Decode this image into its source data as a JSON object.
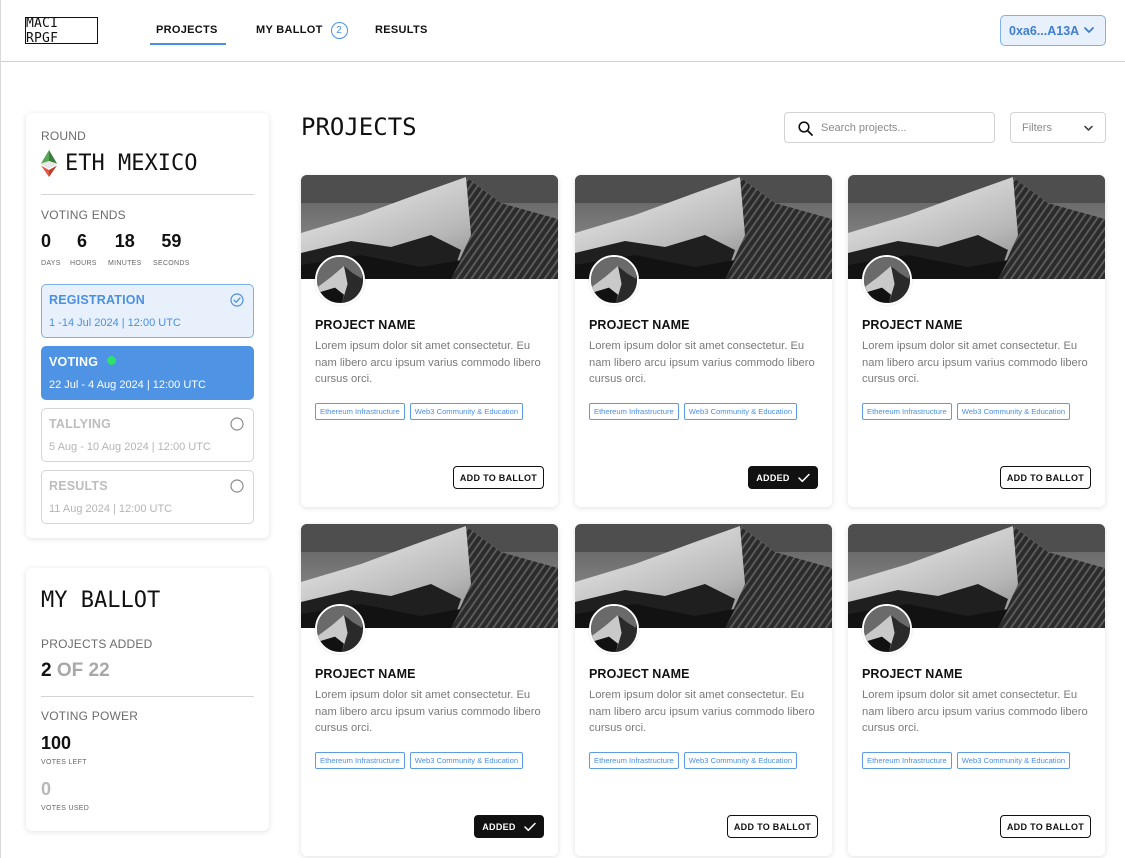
{
  "header": {
    "logo": "MACI RPGF",
    "nav": {
      "projects": "PROJECTS",
      "my_ballot": "MY BALLOT",
      "my_ballot_count": "2",
      "results": "RESULTS"
    },
    "wallet": "0xa6...A13A"
  },
  "round": {
    "label": "ROUND",
    "name": "ETH MEXICO",
    "voting_ends_label": "VOTING ENDS",
    "countdown": [
      {
        "value": "0",
        "unit": "DAYS"
      },
      {
        "value": "6",
        "unit": "HOURS"
      },
      {
        "value": "18",
        "unit": "MINUTES"
      },
      {
        "value": "59",
        "unit": "SECONDS"
      }
    ],
    "stages": [
      {
        "title": "REGISTRATION",
        "dates": "1 -14 Jul 2024 | 12:00 UTC",
        "status": "done"
      },
      {
        "title": "VOTING",
        "dates": "22 Jul - 4 Aug 2024 | 12:00 UTC",
        "status": "active"
      },
      {
        "title": "TALLYING",
        "dates": "5 Aug - 10 Aug 2024 | 12:00 UTC",
        "status": "upcoming"
      },
      {
        "title": "RESULTS",
        "dates": "11 Aug 2024 | 12:00 UTC",
        "status": "upcoming"
      }
    ]
  },
  "ballot": {
    "title": "MY BALLOT",
    "projects_added_label": "PROJECTS ADDED",
    "projects_added": "2",
    "projects_total": "OF 22",
    "voting_power_label": "VOTING POWER",
    "votes_left": "100",
    "votes_left_label": "VOTES LEFT",
    "votes_used": "0",
    "votes_used_label": "VOTES USED"
  },
  "main": {
    "title": "PROJECTS",
    "search_placeholder": "Search projects...",
    "filters_label": "Filters",
    "projects": [
      {
        "name": "PROJECT NAME",
        "description": "Lorem ipsum dolor sit amet consectetur. Eu nam libero arcu ipsum varius commodo libero cursus orci.",
        "tags": [
          "Ethereum Infrastructure",
          "Web3 Community & Education"
        ],
        "button": "ADD TO BALLOT",
        "added": false
      },
      {
        "name": "PROJECT NAME",
        "description": "Lorem ipsum dolor sit amet consectetur. Eu nam libero arcu ipsum varius commodo libero cursus orci.",
        "tags": [
          "Ethereum Infrastructure",
          "Web3 Community & Education"
        ],
        "button": "ADDED",
        "added": true
      },
      {
        "name": "PROJECT NAME",
        "description": "Lorem ipsum dolor sit amet consectetur. Eu nam libero arcu ipsum varius commodo libero cursus orci.",
        "tags": [
          "Ethereum Infrastructure",
          "Web3 Community & Education"
        ],
        "button": "ADD TO BALLOT",
        "added": false
      },
      {
        "name": "PROJECT NAME",
        "description": "Lorem ipsum dolor sit amet consectetur. Eu nam libero arcu ipsum varius commodo libero cursus orci.",
        "tags": [
          "Ethereum Infrastructure",
          "Web3 Community & Education"
        ],
        "button": "ADDED",
        "added": true
      },
      {
        "name": "PROJECT NAME",
        "description": "Lorem ipsum dolor sit amet consectetur. Eu nam libero arcu ipsum varius commodo libero cursus orci.",
        "tags": [
          "Ethereum Infrastructure",
          "Web3 Community & Education"
        ],
        "button": "ADD TO BALLOT",
        "added": false
      },
      {
        "name": "PROJECT NAME",
        "description": "Lorem ipsum dolor sit amet consectetur. Eu nam libero arcu ipsum varius commodo libero cursus orci.",
        "tags": [
          "Ethereum Infrastructure",
          "Web3 Community & Education"
        ],
        "button": "ADD TO BALLOT",
        "added": false
      }
    ]
  },
  "colors": {
    "accent": "#4a90e2",
    "active_stage": "#4f93e4",
    "live_dot": "#2fe06b"
  }
}
